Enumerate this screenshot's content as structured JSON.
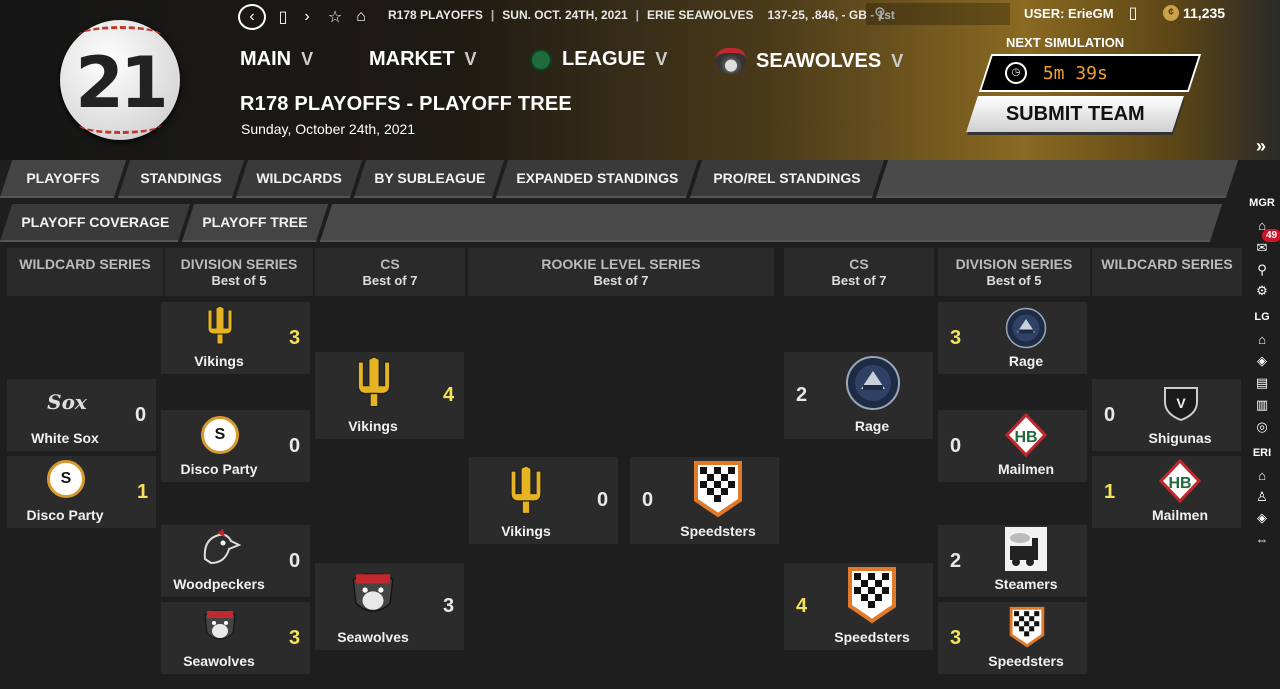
{
  "top_bar": {
    "context": "R178 PLAYOFFS",
    "date": "SUN. OCT. 24TH, 2021",
    "team": "ERIE SEAWOLVES",
    "record": "137-25, .846, - GB - 1st",
    "user": "USER: ErieGM",
    "coins": "11,235"
  },
  "logo_text": "21",
  "main_nav": [
    "MAIN",
    "MARKET",
    "LEAGUE",
    "SEAWOLVES"
  ],
  "page": {
    "title": "R178 PLAYOFFS - PLAYOFF TREE",
    "subtitle": "Sunday, October 24th, 2021"
  },
  "simulation": {
    "label": "NEXT SIMULATION",
    "time": "5m 39s",
    "submit": "SUBMIT TEAM"
  },
  "tabs_row1": [
    "PLAYOFFS",
    "STANDINGS",
    "WILDCARDS",
    "BY SUBLEAGUE",
    "EXPANDED STANDINGS",
    "PRO/REL STANDINGS"
  ],
  "tabs_row2": [
    "PLAYOFF COVERAGE",
    "PLAYOFF TREE"
  ],
  "right_sidebar": {
    "mgr": "MGR",
    "lg": "LG",
    "eri": "ERI",
    "mail_badge": "49"
  },
  "columns": [
    {
      "title": "WILDCARD SERIES",
      "sub": ""
    },
    {
      "title": "DIVISION SERIES",
      "sub": "Best of 5"
    },
    {
      "title": "CS",
      "sub": "Best of 7"
    },
    {
      "title": "ROOKIE LEVEL SERIES",
      "sub": "Best of 7"
    },
    {
      "title": "CS",
      "sub": "Best of 7"
    },
    {
      "title": "DIVISION SERIES",
      "sub": "Best of 5"
    },
    {
      "title": "WILDCARD SERIES",
      "sub": ""
    }
  ],
  "teams": {
    "wc_l1": {
      "name": "White Sox",
      "score": "0",
      "logo_text": "Sox"
    },
    "wc_l2": {
      "name": "Disco Party",
      "score": "1",
      "logo_text": "S"
    },
    "ds_l1": {
      "name": "Vikings",
      "score": "3"
    },
    "ds_l2": {
      "name": "Disco Party",
      "score": "0",
      "logo_text": "S"
    },
    "ds_l3": {
      "name": "Woodpeckers",
      "score": "0"
    },
    "ds_l4": {
      "name": "Seawolves",
      "score": "3"
    },
    "cs_l1": {
      "name": "Vikings",
      "score": "4"
    },
    "cs_l2": {
      "name": "Seawolves",
      "score": "3"
    },
    "fin_l": {
      "name": "Vikings",
      "score": "0"
    },
    "fin_r": {
      "name": "Speedsters",
      "score": "0"
    },
    "cs_r1": {
      "name": "Rage",
      "score": "2"
    },
    "cs_r2": {
      "name": "Speedsters",
      "score": "4"
    },
    "ds_r1": {
      "name": "Rage",
      "score": "3"
    },
    "ds_r2": {
      "name": "Mailmen",
      "score": "0",
      "logo_text": "HB"
    },
    "ds_r3": {
      "name": "Steamers",
      "score": "2"
    },
    "ds_r4": {
      "name": "Speedsters",
      "score": "3"
    },
    "wc_r1": {
      "name": "Shigunas",
      "score": "0",
      "logo_text": "V"
    },
    "wc_r2": {
      "name": "Mailmen",
      "score": "1",
      "logo_text": "HB"
    }
  },
  "colors": {
    "winner": "#f4e35a",
    "accent": "#c9a24a",
    "panel": "#2b2b2b"
  }
}
